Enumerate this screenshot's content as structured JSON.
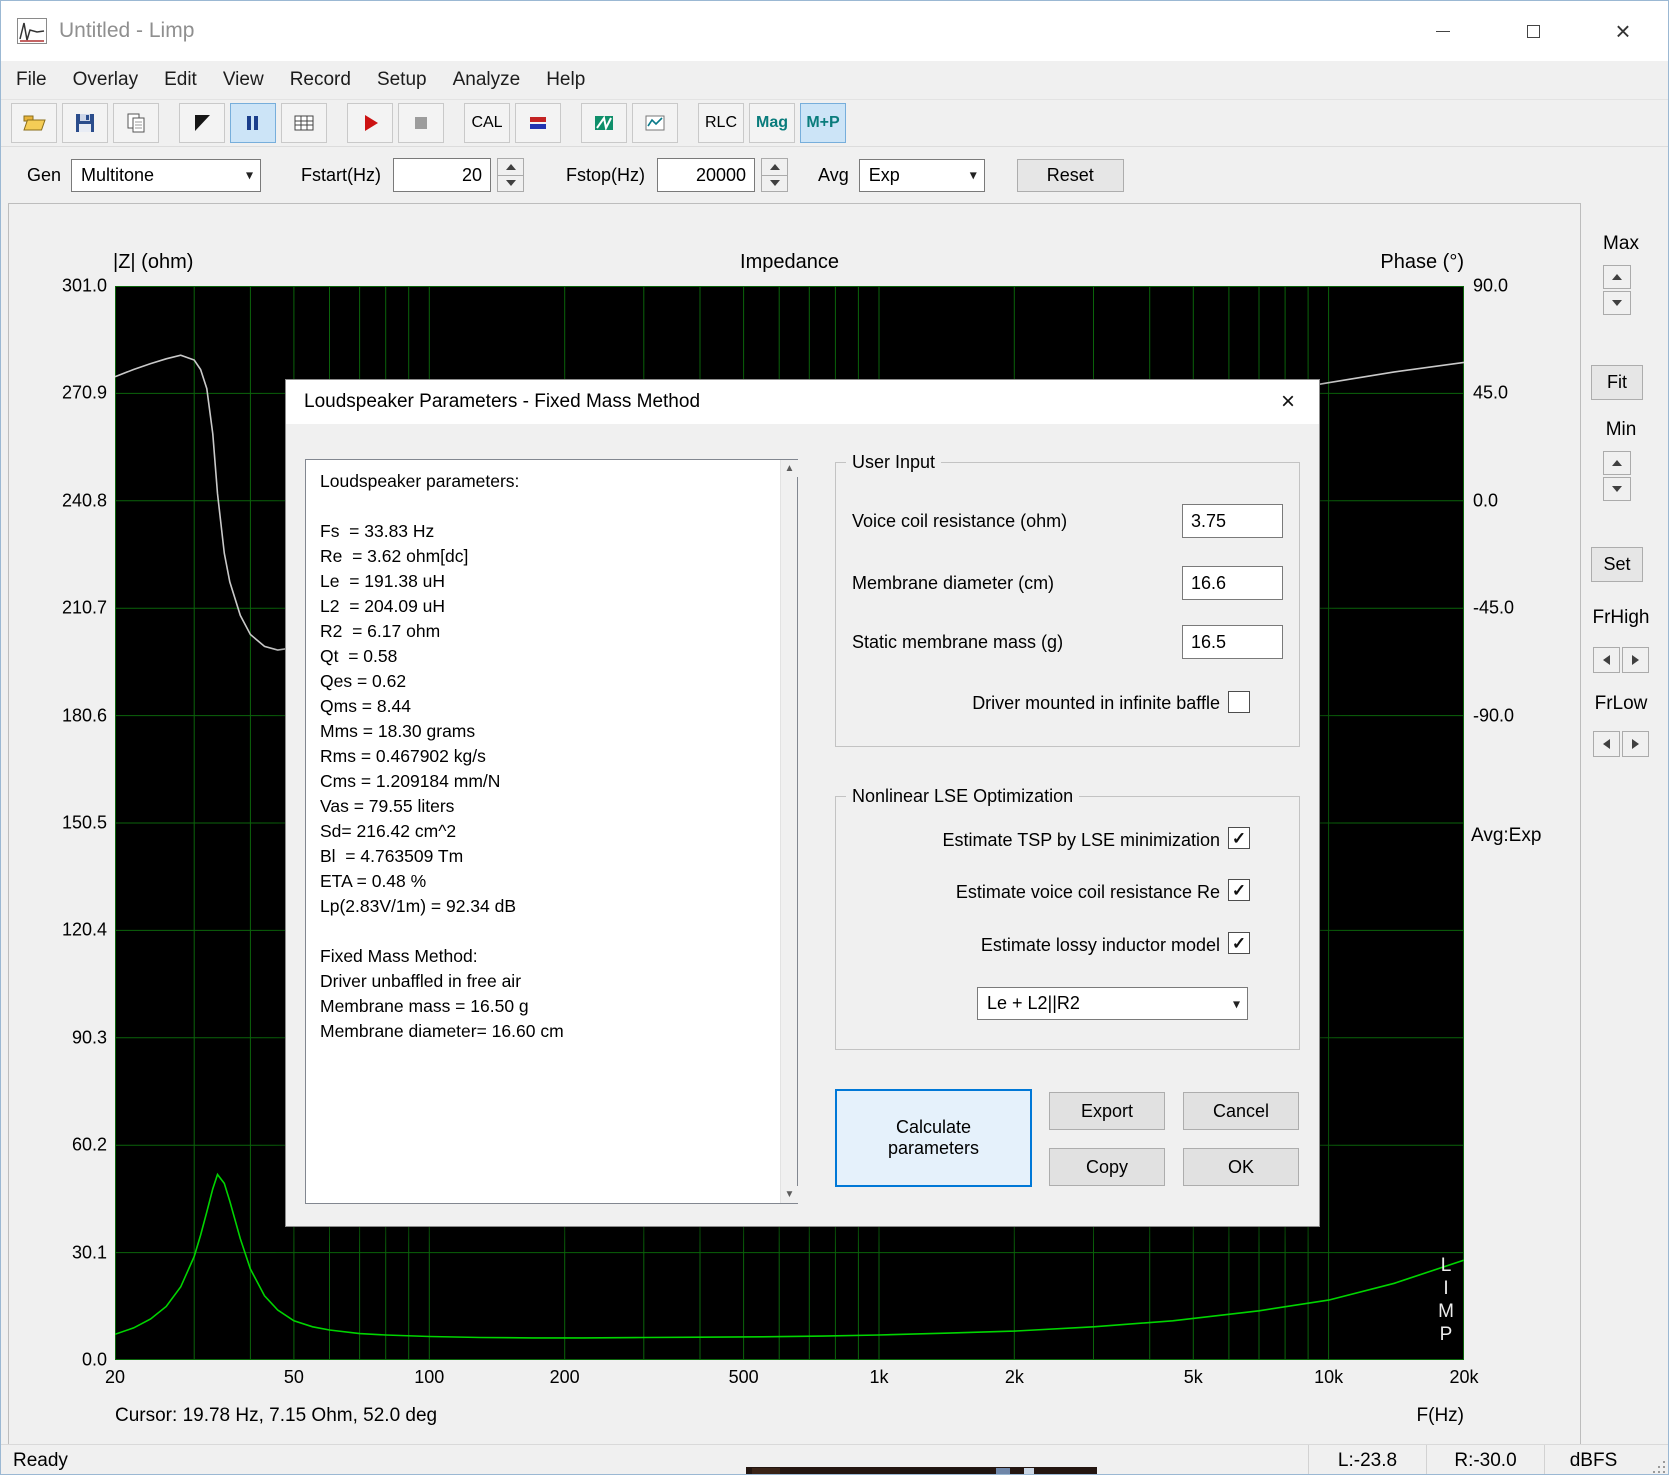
{
  "window": {
    "title": "Untitled - Limp"
  },
  "icons": {
    "chevron_down": "▾",
    "close": "×",
    "check": "✓",
    "scroll_up": "▲",
    "scroll_down": "▼"
  },
  "menu": {
    "items": [
      "File",
      "Overlay",
      "Edit",
      "View",
      "Record",
      "Setup",
      "Analyze",
      "Help"
    ]
  },
  "toolbar": {
    "cal_label": "CAL",
    "rlc_label": "RLC",
    "mag_label": "Mag",
    "mp_label": "M+P"
  },
  "controls": {
    "gen_label": "Gen",
    "gen_value": "Multitone",
    "fstart_label": "Fstart(Hz)",
    "fstart_value": "20",
    "fstop_label": "Fstop(Hz)",
    "fstop_value": "20000",
    "avg_label": "Avg",
    "avg_value": "Exp",
    "reset_label": "Reset"
  },
  "chart": {
    "left_axis_title": "|Z| (ohm)",
    "title": "Impedance",
    "right_axis_title": "Phase (°)",
    "z_ticks": [
      "301.0",
      "270.9",
      "240.8",
      "210.7",
      "180.6",
      "150.5",
      "120.4",
      "90.3",
      "60.2",
      "30.1",
      "0.0"
    ],
    "phase_ticks": [
      "90.0",
      "45.0",
      "0.0",
      "-45.0",
      "-90.0"
    ],
    "x_ticks": [
      "20",
      "50",
      "100",
      "200",
      "500",
      "1k",
      "2k",
      "5k",
      "10k",
      "20k"
    ],
    "x_label": "F(Hz)",
    "cursor_text": "Cursor: 19.78 Hz, 7.15 Ohm, 52.0 deg",
    "avg_text": "Avg:Exp",
    "limp_letters": [
      "L",
      "I",
      "M",
      "P"
    ]
  },
  "right_panel": {
    "max_label": "Max",
    "fit_label": "Fit",
    "min_label": "Min",
    "set_label": "Set",
    "frhigh_label": "FrHigh",
    "frlow_label": "FrLow"
  },
  "dialog": {
    "title": "Loudspeaker Parameters - Fixed Mass Method",
    "params_text": "Loudspeaker parameters:\n\nFs  = 33.83 Hz\nRe  = 3.62 ohm[dc]\nLe  = 191.38 uH\nL2  = 204.09 uH\nR2  = 6.17 ohm\nQt  = 0.58\nQes = 0.62\nQms = 8.44\nMms = 18.30 grams\nRms = 0.467902 kg/s\nCms = 1.209184 mm/N\nVas = 79.55 liters\nSd= 216.42 cm^2\nBl  = 4.763509 Tm\nETA = 0.48 %\nLp(2.83V/1m) = 92.34 dB\n\nFixed Mass Method:\nDriver unbaffled in free air\nMembrane mass = 16.50 g\nMembrane diameter= 16.60 cm",
    "user_input": {
      "title": "User Input",
      "fields": [
        {
          "label": "Voice coil resistance (ohm)",
          "value": "3.75"
        },
        {
          "label": "Membrane diameter (cm)",
          "value": "16.6"
        },
        {
          "label": "Static membrane mass (g)",
          "value": "16.5"
        }
      ],
      "baffle_label": "Driver mounted in infinite baffle",
      "baffle_checked": false
    },
    "lse": {
      "title": "Nonlinear LSE Optimization",
      "options": [
        {
          "label": "Estimate TSP by LSE minimization",
          "checked": true
        },
        {
          "label": "Estimate voice coil resistance Re",
          "checked": true
        },
        {
          "label": "Estimate lossy inductor model",
          "checked": true
        }
      ],
      "model_value": "Le + L2||R2"
    },
    "buttons": {
      "calculate": "Calculate parameters",
      "export": "Export",
      "cancel": "Cancel",
      "copy": "Copy",
      "ok": "OK"
    }
  },
  "status": {
    "ready": "Ready",
    "left_level": "L:-23.8",
    "right_level": "R:-30.0",
    "unit": "dBFS"
  },
  "chart_data": {
    "type": "line",
    "title": "Impedance",
    "x_axis": {
      "label": "F(Hz)",
      "scale": "log",
      "min": 20,
      "max": 20000,
      "ticks": [
        "20",
        "50",
        "100",
        "200",
        "500",
        "1k",
        "2k",
        "5k",
        "10k",
        "20k"
      ]
    },
    "y_left": {
      "label": "|Z| (ohm)",
      "min": 0,
      "max": 301.0,
      "ticks": [
        301.0,
        270.9,
        240.8,
        210.7,
        180.6,
        150.5,
        120.4,
        90.3,
        60.2,
        30.1,
        0.0
      ]
    },
    "y_right": {
      "label": "Phase (°)",
      "ticks": [
        90.0,
        45.0,
        0.0,
        -45.0,
        -90.0
      ],
      "degrees_per_division": 45,
      "top_value": 90
    },
    "grid": true,
    "legend_position": "none",
    "colors": {
      "impedance": "#00d400",
      "phase": "#c9c9c9",
      "grid": "#0b640b",
      "background": "#000000"
    },
    "series": [
      {
        "name": "Impedance magnitude (ohm)",
        "x": [
          20,
          22,
          24,
          26,
          28,
          30,
          31,
          32,
          33,
          33.8,
          35,
          36,
          38,
          40,
          43,
          46,
          50,
          55,
          60,
          70,
          80,
          100,
          130,
          170,
          220,
          300,
          400,
          550,
          750,
          1000,
          1400,
          2000,
          3000,
          4500,
          7000,
          10000,
          14000,
          20000
        ],
        "y": [
          7.2,
          9,
          11.5,
          15,
          20.5,
          29,
          35,
          41.5,
          48,
          52,
          49.5,
          44.5,
          34,
          25.5,
          18,
          14,
          11,
          9.3,
          8.4,
          7.4,
          7,
          6.6,
          6.3,
          6.2,
          6.2,
          6.3,
          6.4,
          6.5,
          6.7,
          7,
          7.5,
          8.1,
          9.3,
          11,
          13.8,
          16.8,
          21.5,
          28
        ]
      },
      {
        "name": "Phase (deg)",
        "x": [
          20,
          22,
          24,
          26,
          28,
          30,
          31,
          32,
          33,
          33.8,
          35,
          36,
          38,
          40,
          43,
          46,
          50,
          55,
          60,
          70,
          80,
          100,
          130,
          170,
          220,
          300,
          400,
          550,
          750,
          1000,
          1400,
          2000,
          3000,
          4500,
          7000,
          10000,
          14000,
          20000
        ],
        "y": [
          52,
          55,
          57.5,
          59.5,
          61,
          59,
          55,
          47,
          28,
          3,
          -22,
          -34,
          -48,
          -56,
          -61,
          -62.5,
          -61.5,
          -59,
          -55,
          -48,
          -42,
          -33,
          -25,
          -18,
          -12,
          -6,
          -1,
          4,
          9,
          13.5,
          18.5,
          24,
          30.5,
          37.5,
          44.5,
          49.5,
          54,
          58
        ]
      }
    ],
    "cursor": {
      "freq_hz": 19.78,
      "ohm": 7.15,
      "deg": 52.0
    }
  }
}
